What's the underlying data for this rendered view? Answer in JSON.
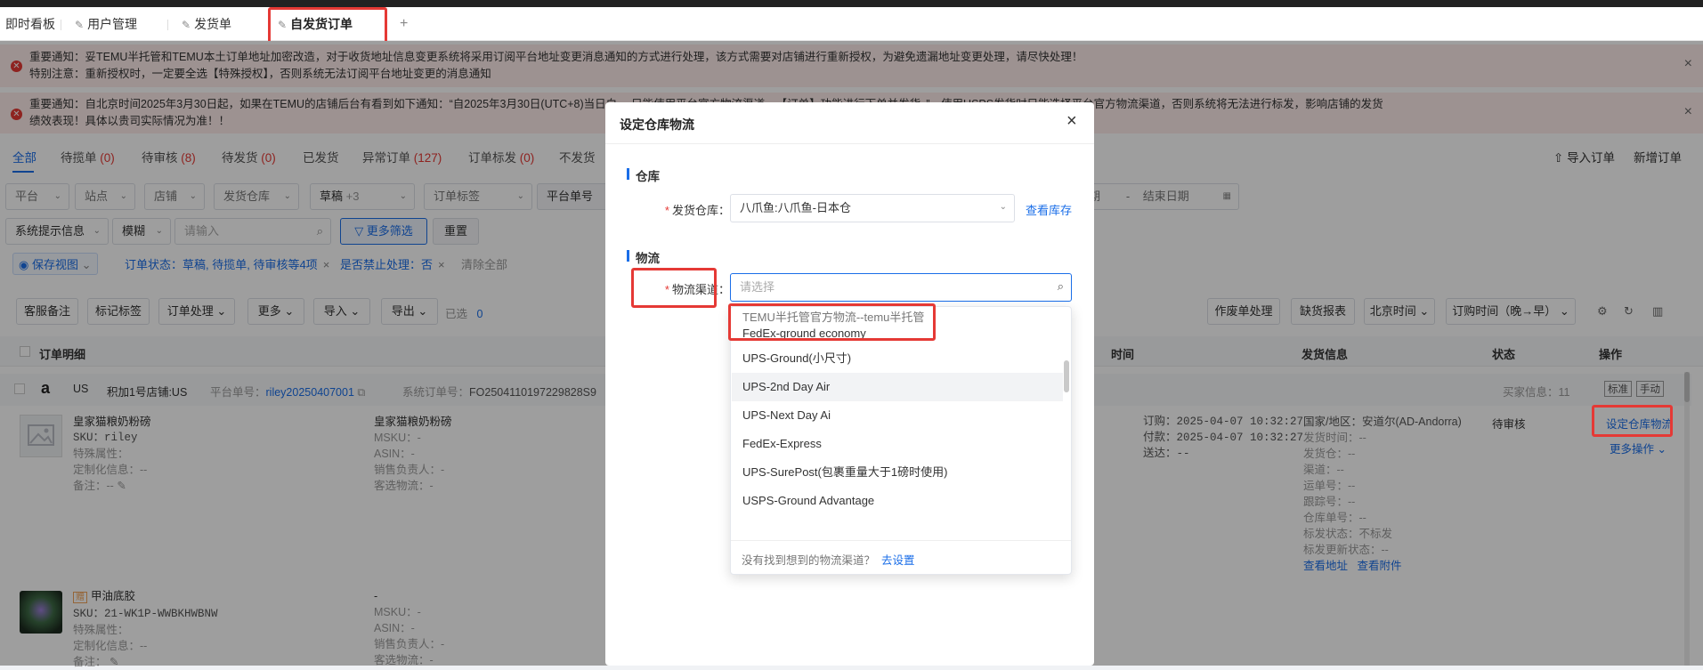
{
  "page_tabs": [
    {
      "label": "即时看板"
    },
    {
      "label": "用户管理"
    },
    {
      "label": "发货单"
    },
    {
      "label": "自发货订单"
    }
  ],
  "add_tab": "+",
  "notices": [
    {
      "line1": "重要通知：妥TEMU半托管和TEMU本土订单地址加密改造，对于收货地址信息变更系统将采用订阅平台地址变更消息通知的方式进行处理，该方式需要对店铺进行重新授权，为避免遗漏地址变更处理，请尽快处理！",
      "line2": "特别注意：重新授权时，一定要全选【特殊授权】，否则系统无法订阅平台地址变更的消息通知"
    },
    {
      "line1": "重要通知：自北京时间2025年3月30日起，如果在TEMU的店铺后台有看到如下通知：“自2025年3月30日(UTC+8)当日白… 只能使用平台官方物流渠道…【订单】功能进行下单并发货。”，使用USPS发货时只能选择平台官方物流渠道，否则系统将无法进行标发，影响店铺的发货",
      "line2": "绩效表现！具体以贵司实际情况为准！！"
    }
  ],
  "filter_tabs": [
    {
      "label": "全部",
      "count": ""
    },
    {
      "label": "待揽单",
      "count": "(0)"
    },
    {
      "label": "待审核",
      "count": "(8)"
    },
    {
      "label": "待发货",
      "count": "(0)"
    },
    {
      "label": "已发货",
      "count": ""
    },
    {
      "label": "异常订单",
      "count": "(127)"
    },
    {
      "label": "订单标发",
      "count": "(0)"
    },
    {
      "label": "不发货",
      "count": ""
    }
  ],
  "header_actions": {
    "import": "导入订单",
    "new": "新增订单"
  },
  "filters_row1": [
    "平台",
    "站点",
    "店铺",
    "发货仓库",
    "草稿",
    "+3",
    "订单标签",
    "平台单号"
  ],
  "date_range": {
    "start": "期",
    "sep": "-",
    "end": "结束日期"
  },
  "filters_row2": {
    "sys": "系统提示信息",
    "fuzzy": "模糊",
    "placeholder": "请输入",
    "more": "更多筛选",
    "reset": "重置"
  },
  "chips": {
    "save_view": "保存视图",
    "status": "订单状态：草稿, 待揽单, 待审核等4项",
    "ban": "是否禁止处理：否",
    "clear": "清除全部"
  },
  "toolbar": [
    "客服备注",
    "标记标签",
    "订单处理",
    "更多",
    "导入",
    "导出"
  ],
  "selected": {
    "label": "已选",
    "count": "0"
  },
  "toolbar_right": [
    "作废单处理",
    "缺货报表",
    "北京时间",
    "订购时间（晚→早）"
  ],
  "table_headers": {
    "detail": "订单明细",
    "time": "时间",
    "ship": "发货信息",
    "status": "状态",
    "ops": "操作"
  },
  "order": {
    "site": "US",
    "store": "积加1号店铺:US",
    "platform_label": "平台单号：",
    "platform_no": "riley20250407001",
    "sys_label": "系统订单号：",
    "sys_no": "FO2504110197229828S9",
    "buyer_info": "买家信息：11",
    "tags": [
      "标准",
      "手动"
    ],
    "items": [
      {
        "name": "皇家猫粮奶粉磅",
        "sku": "SKU：riley",
        "attr": "特殊属性：",
        "custom": "定制化信息：--",
        "remark": "备注：--",
        "name2": "皇家猫粮奶粉磅",
        "msku": "MSKU：-",
        "asin": "ASIN：-",
        "sales": "销售负责人：-",
        "logistics": "客选物流：-"
      },
      {
        "name": "甲油底胶",
        "sku": "SKU：21-WK1P-WWBKHWBNW",
        "attr": "特殊属性：",
        "custom": "定制化信息：--",
        "remark": "备注：",
        "name2": "-",
        "msku": "MSKU：-",
        "asin": "ASIN：-",
        "sales": "销售负责人：-",
        "logistics": "客选物流：-"
      }
    ],
    "times": [
      "订购：2025-04-07 10:32:27",
      "付款：2025-04-07 10:32:27",
      "送达：--"
    ],
    "ship": [
      "国家/地区：安道尔(AD-Andorra)",
      "发货时间：--",
      "发货仓：--",
      "渠道：--",
      "运单号：--",
      "跟踪号：--",
      "仓库单号：--",
      "标发状态：不标发",
      "标发更新状态：--"
    ],
    "ship_links": [
      "查看地址",
      "查看附件"
    ],
    "status": "待审核",
    "op_primary": "设定仓库物流",
    "op_more": "更多操作"
  },
  "modal": {
    "title": "设定仓库物流",
    "warehouse_section": "仓库",
    "warehouse_label": "发货仓库：",
    "warehouse_value": "八爪鱼:八爪鱼-日本仓",
    "view_stock": "查看库存",
    "logistics_section": "物流",
    "channel_label": "物流渠道：",
    "channel_placeholder": "请选择",
    "options": [
      "TEMU半托管官方物流--temu半托管",
      "FedEx-ground economy",
      "UPS-Ground(小尺寸)",
      "UPS-2nd Day Air",
      "UPS-Next Day Ai",
      "FedEx-Express",
      "UPS-SurePost(包裹重量大于1磅时使用)",
      "USPS-Ground Advantage"
    ],
    "not_found": "没有找到想到的物流渠道？",
    "go_setup": "去设置"
  }
}
